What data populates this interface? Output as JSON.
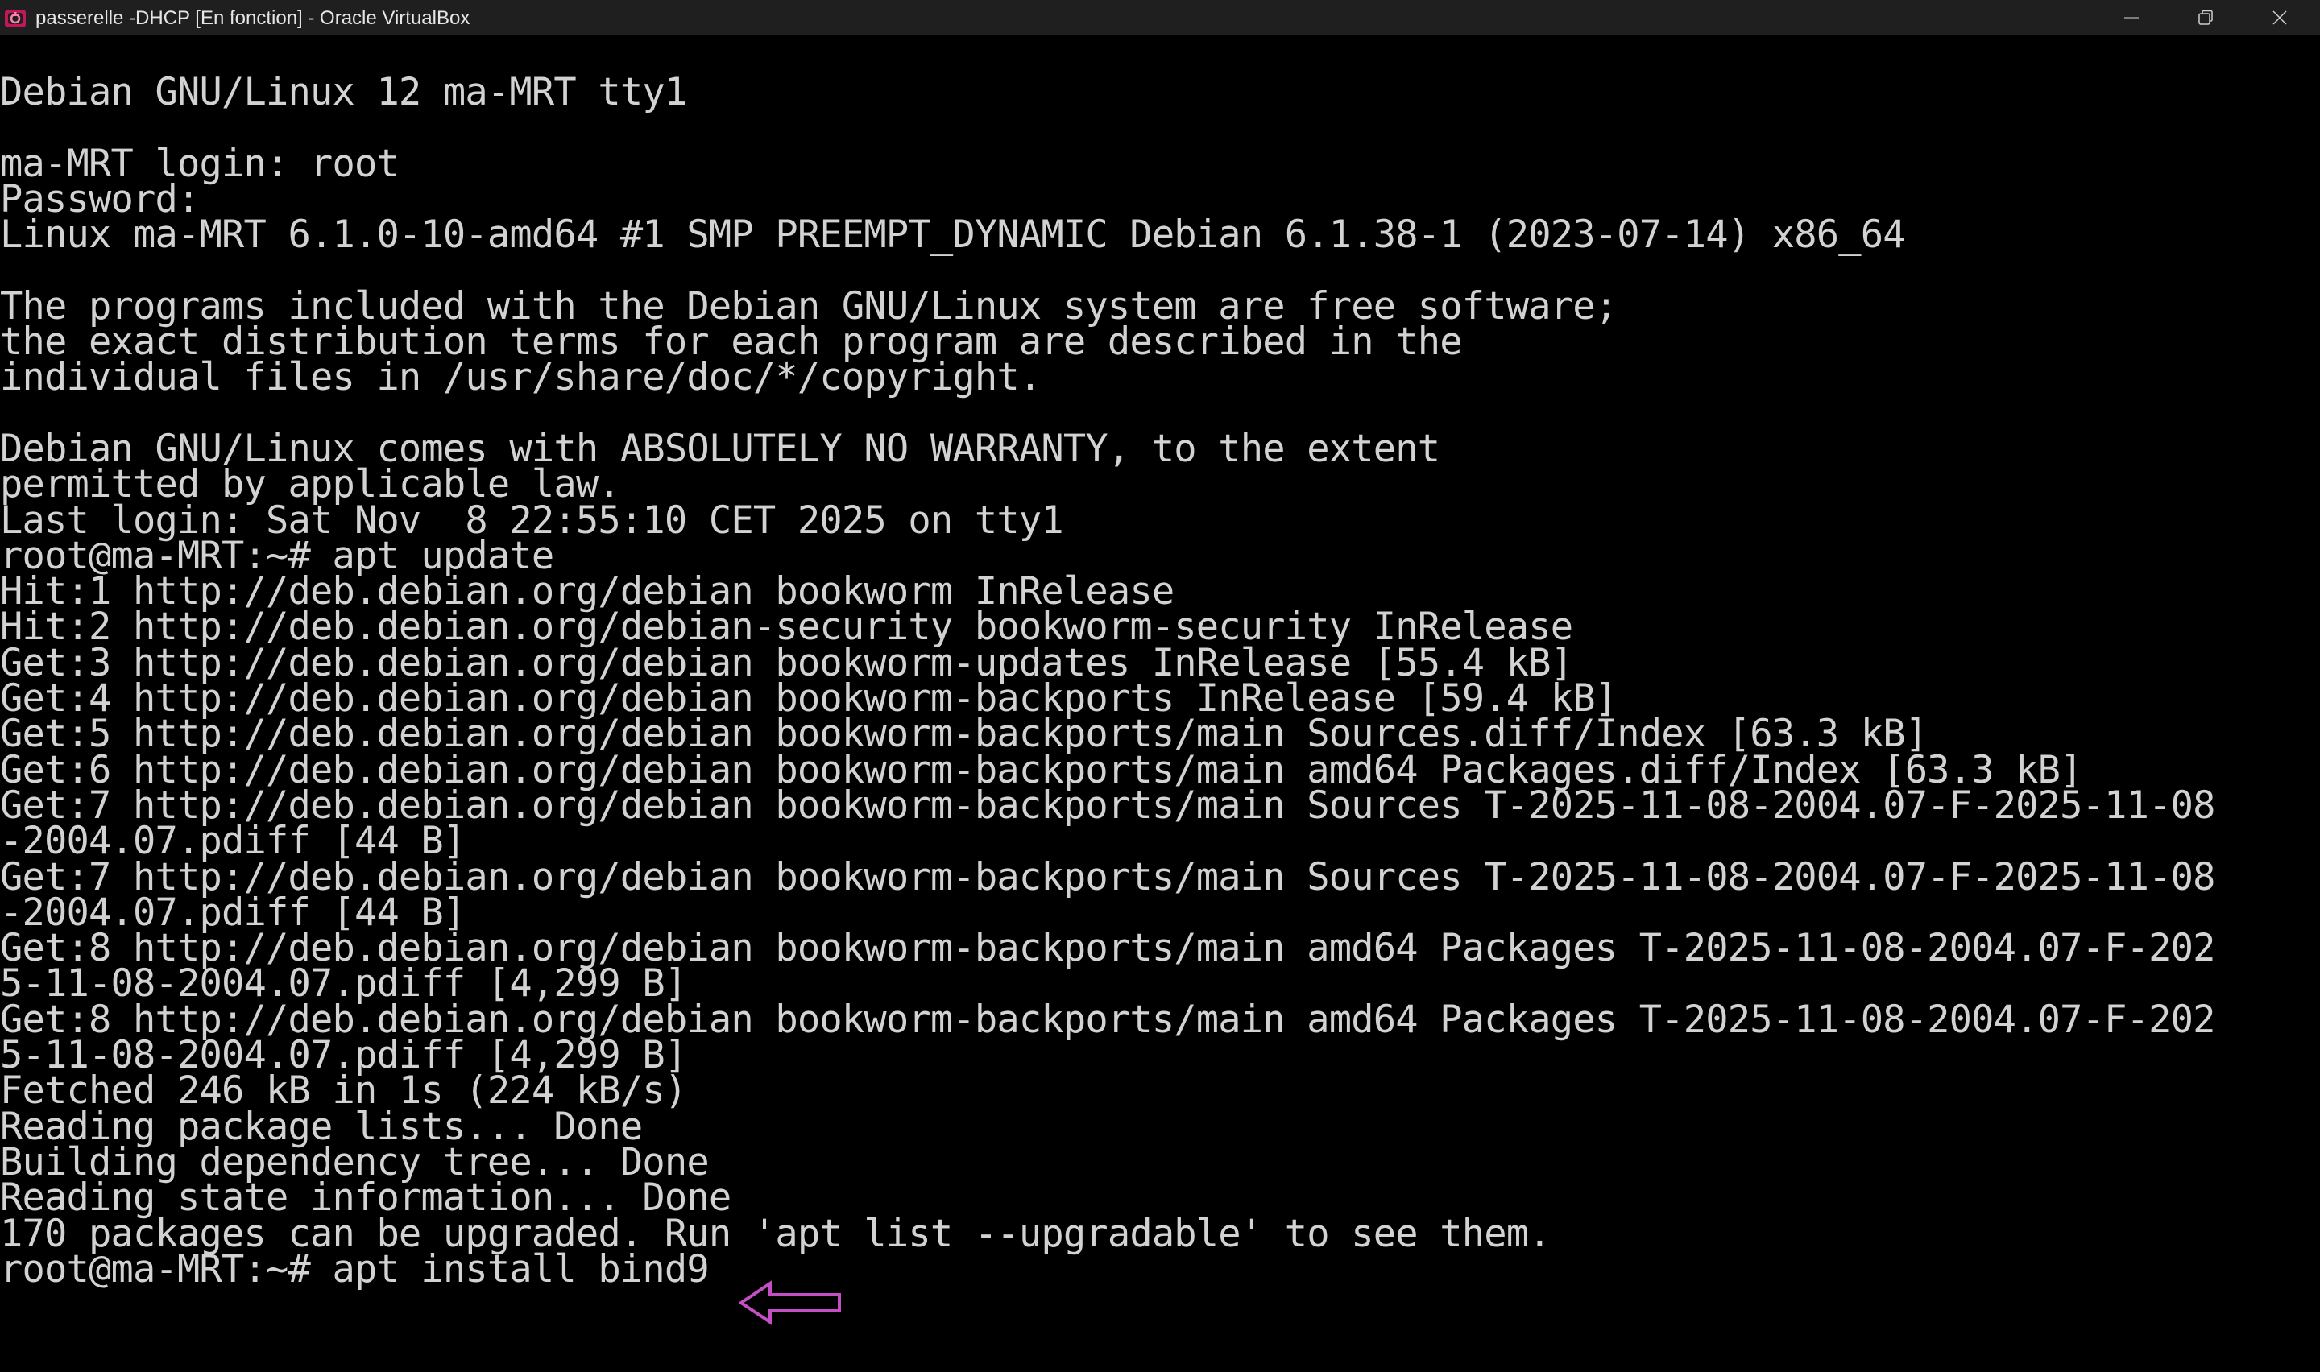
{
  "window": {
    "title": "passerelle -DHCP [En fonction] - Oracle VirtualBox",
    "icon": "virtualbox-icon",
    "controls": [
      "minimize-icon",
      "restore-icon",
      "close-icon"
    ]
  },
  "terminal": {
    "lines": [
      "Debian GNU/Linux 12 ma-MRT tty1",
      "",
      "ma-MRT login: root",
      "Password:",
      "Linux ma-MRT 6.1.0-10-amd64 #1 SMP PREEMPT_DYNAMIC Debian 6.1.38-1 (2023-07-14) x86_64",
      "",
      "The programs included with the Debian GNU/Linux system are free software;",
      "the exact distribution terms for each program are described in the",
      "individual files in /usr/share/doc/*/copyright.",
      "",
      "Debian GNU/Linux comes with ABSOLUTELY NO WARRANTY, to the extent",
      "permitted by applicable law.",
      "Last login: Sat Nov  8 22:55:10 CET 2025 on tty1",
      "root@ma-MRT:~# apt update",
      "Hit:1 http://deb.debian.org/debian bookworm InRelease",
      "Hit:2 http://deb.debian.org/debian-security bookworm-security InRelease",
      "Get:3 http://deb.debian.org/debian bookworm-updates InRelease [55.4 kB]",
      "Get:4 http://deb.debian.org/debian bookworm-backports InRelease [59.4 kB]",
      "Get:5 http://deb.debian.org/debian bookworm-backports/main Sources.diff/Index [63.3 kB]",
      "Get:6 http://deb.debian.org/debian bookworm-backports/main amd64 Packages.diff/Index [63.3 kB]",
      "Get:7 http://deb.debian.org/debian bookworm-backports/main Sources T-2025-11-08-2004.07-F-2025-11-08",
      "-2004.07.pdiff [44 B]",
      "Get:7 http://deb.debian.org/debian bookworm-backports/main Sources T-2025-11-08-2004.07-F-2025-11-08",
      "-2004.07.pdiff [44 B]",
      "Get:8 http://deb.debian.org/debian bookworm-backports/main amd64 Packages T-2025-11-08-2004.07-F-202",
      "5-11-08-2004.07.pdiff [4,299 B]",
      "Get:8 http://deb.debian.org/debian bookworm-backports/main amd64 Packages T-2025-11-08-2004.07-F-202",
      "5-11-08-2004.07.pdiff [4,299 B]",
      "Fetched 246 kB in 1s (224 kB/s)",
      "Reading package lists... Done",
      "Building dependency tree... Done",
      "Reading state information... Done",
      "170 packages can be upgraded. Run 'apt list --upgradable' to see them.",
      "root@ma-MRT:~# apt install bind9"
    ]
  },
  "annotation": {
    "icon": "left-arrow-icon",
    "color": "#c44fc4"
  }
}
